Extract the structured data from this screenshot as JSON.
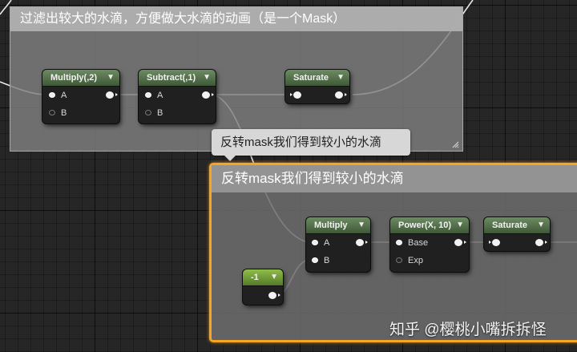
{
  "comments": {
    "top_title": "过滤出较大的水滴，方便做大水滴的动画（是一个Mask）",
    "bottom_title": "反转mask我们得到较小的水滴",
    "bubble_text": "反转mask我们得到较小的水滴"
  },
  "nodes": {
    "multiply_top": {
      "title": "Multiply(,2)",
      "pin_a": "A",
      "pin_b": "B"
    },
    "subtract": {
      "title": "Subtract(,1)",
      "pin_a": "A",
      "pin_b": "B"
    },
    "saturate_top": {
      "title": "Saturate"
    },
    "multiply": {
      "title": "Multiply",
      "pin_a": "A",
      "pin_b": "B"
    },
    "power": {
      "title": "Power(X, 10)",
      "pin_base": "Base",
      "pin_exp": "Exp"
    },
    "saturate": {
      "title": "Saturate"
    },
    "constant": {
      "title": "-1"
    }
  },
  "icons": {
    "chevron": "▼",
    "resize": "resize-grip-icon"
  },
  "colors": {
    "selection_border": "#f5a623",
    "node_header": "#5a7650",
    "comment_fill": "#808080"
  },
  "watermark": "知乎 @樱桃小嘴拆拆怪"
}
